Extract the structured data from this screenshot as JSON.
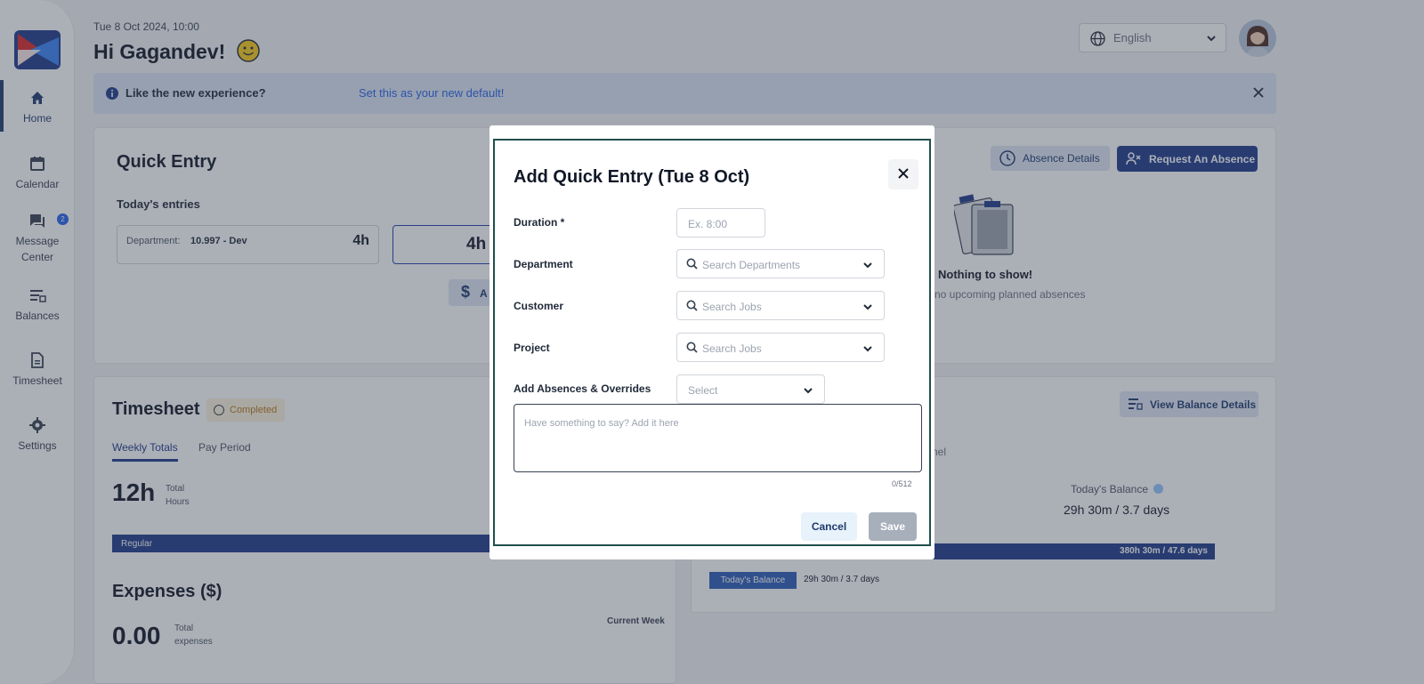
{
  "sidebar": {
    "items": [
      {
        "label": "Home",
        "icon": "home-icon"
      },
      {
        "label": "Calendar",
        "icon": "calendar-icon"
      },
      {
        "label": "Message Center",
        "icon": "chat-icon",
        "badge": "2"
      },
      {
        "label": "Balances",
        "icon": "balances-icon"
      },
      {
        "label": "Timesheet",
        "icon": "document-icon"
      },
      {
        "label": "Settings",
        "icon": "gear-icon"
      }
    ],
    "message_line1": "Message",
    "message_line2": "Center"
  },
  "header": {
    "datetime": "Tue 8 Oct 2024, 10:00",
    "greeting": "Hi Gagandev!",
    "language": "English"
  },
  "banner": {
    "message": "Like the new experience?",
    "link": "Set this as your new default!"
  },
  "quick_entry": {
    "title": "Quick Entry",
    "todays_entries": "Today's entries",
    "entry": {
      "dept_label": "Department:",
      "dept_value": "10.997 - Dev",
      "hours": "4h"
    },
    "total_hours": "4h",
    "add_expense_label": "A",
    "absence_details": "Absence Details",
    "request_absence": "Request An Absence",
    "nothing_title": "Nothing to show!",
    "nothing_sub": "no upcoming planned absences"
  },
  "timesheet": {
    "title": "Timesheet",
    "status": "Completed",
    "tabs": [
      "Weekly Totals",
      "Pay Period"
    ],
    "total": "12h",
    "total_label1": "Total",
    "total_label2": "Hours",
    "bar_label": "Regular"
  },
  "expenses": {
    "title": "Expenses ($)",
    "total": "0.00",
    "label1": "Total",
    "label2": "expenses",
    "period": "Current Week"
  },
  "balances": {
    "view_details": "View Balance Details",
    "partial_text": "nel",
    "todays_balance_label": "Today's Balance",
    "todays_balance_value": "29h 30m / 3.7 days",
    "bar_value": "380h 30m / 47.6 days",
    "chip_label": "Today's Balance",
    "chip_value": "29h 30m / 3.7 days"
  },
  "modal": {
    "title": "Add Quick Entry (Tue 8 Oct)",
    "fields": {
      "duration_label": "Duration *",
      "duration_placeholder": "Ex. 8:00",
      "department_label": "Department",
      "department_placeholder": "Search Departments",
      "customer_label": "Customer",
      "customer_placeholder": "Search Jobs",
      "project_label": "Project",
      "project_placeholder": "Search Jobs",
      "absences_label": "Add Absences & Overrides",
      "absences_placeholder": "Select"
    },
    "comment_placeholder": "Have something to say? Add it here",
    "char_count": "0/512",
    "cancel": "Cancel",
    "save": "Save"
  },
  "colors": {
    "brand_navy": "#1e3a8a",
    "accent_blue": "#2563eb",
    "modal_border": "#1f4e4e",
    "completed_badge": "#fdf3dc"
  }
}
